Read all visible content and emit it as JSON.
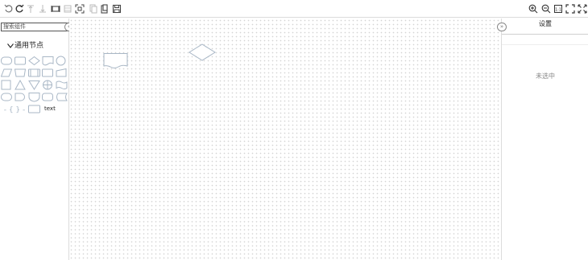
{
  "toolbar": {
    "left_icons": [
      "undo-icon",
      "redo-icon",
      "bring-to-front-icon",
      "send-to-back-icon",
      "fit-width-icon",
      "select-all-icon",
      "crop-icon",
      "copy-icon",
      "save-icon"
    ],
    "right_icons": [
      "zoom-in-icon",
      "zoom-out-icon",
      "reset-zoom-icon",
      "fit-view-icon",
      "fullscreen-icon"
    ]
  },
  "sidebar": {
    "search_placeholder": "搜索组件",
    "group_title": "通用节点",
    "text_node_label": "text"
  },
  "settings": {
    "title": "设置",
    "empty_message": "未选中"
  },
  "colors": {
    "border": "#dcdcdc",
    "icon": "#555555",
    "shape_stroke": "#a9b7c6"
  }
}
